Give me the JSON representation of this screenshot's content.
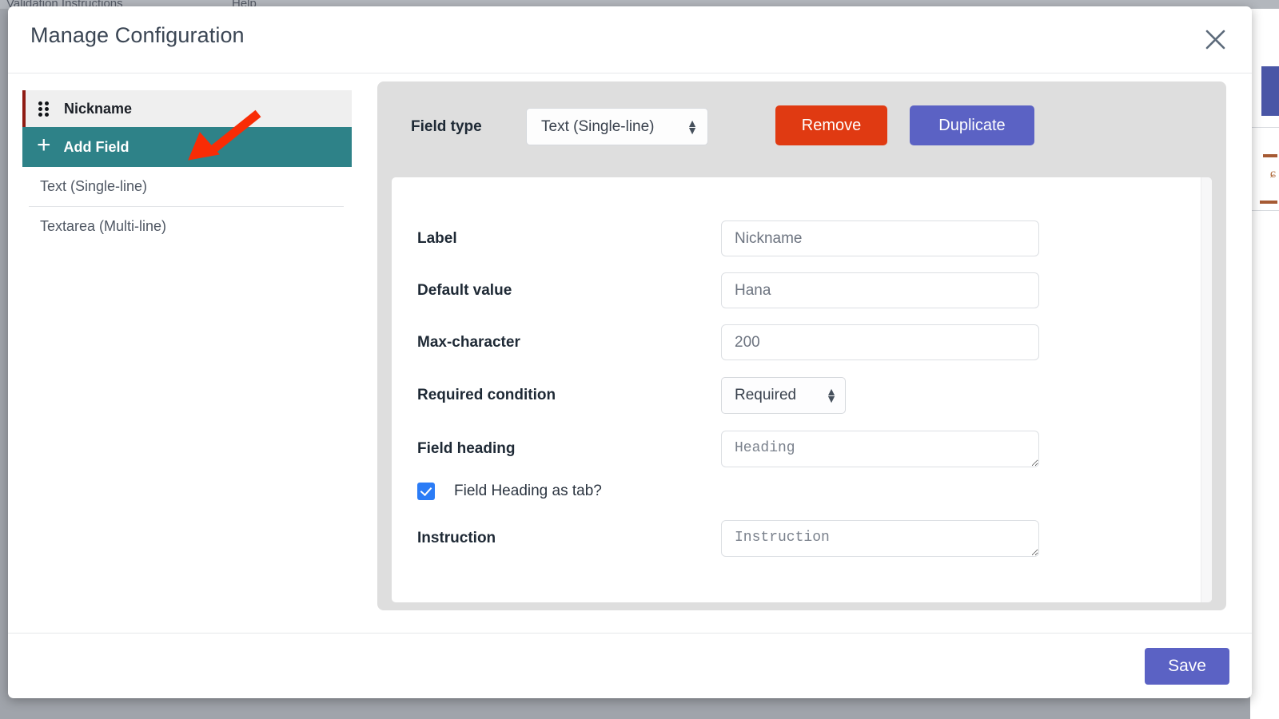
{
  "background": {
    "menu_left": "Validation Instructions",
    "menu_right": "Help"
  },
  "modal": {
    "title": "Manage Configuration",
    "close_icon": "close-icon"
  },
  "sidebar": {
    "field_item": {
      "label": "Nickname",
      "drag_icon": "drag-handle-icon"
    },
    "add_field": {
      "label": "Add Field",
      "icon": "plus-icon"
    },
    "field_types": [
      {
        "label": "Text (Single-line)"
      },
      {
        "label": "Textarea (Multi-line)"
      }
    ]
  },
  "toolbar": {
    "field_type_label": "Field type",
    "field_type_value": "Text (Single-line)",
    "remove_label": "Remove",
    "duplicate_label": "Duplicate"
  },
  "form": {
    "label_row": {
      "label": "Label",
      "value": "Nickname"
    },
    "default_row": {
      "label": "Default value",
      "value": "Hana"
    },
    "max_char_row": {
      "label": "Max-character",
      "value": "200"
    },
    "required_row": {
      "label": "Required condition",
      "value": "Required"
    },
    "heading_row": {
      "label": "Field heading",
      "placeholder": "Heading"
    },
    "heading_tab_row": {
      "label": "Field Heading as tab?",
      "checked": true
    },
    "instruction_row": {
      "label": "Instruction",
      "placeholder": "Instruction"
    }
  },
  "footer": {
    "save_label": "Save"
  },
  "colors": {
    "accent_teal": "#2e8288",
    "remove_red": "#e03a12",
    "primary_indigo": "#5b62c4",
    "checkbox_blue": "#2b7cf6",
    "field_marker_red": "#8f1b13",
    "annotation_arrow_red": "#f92c05"
  }
}
